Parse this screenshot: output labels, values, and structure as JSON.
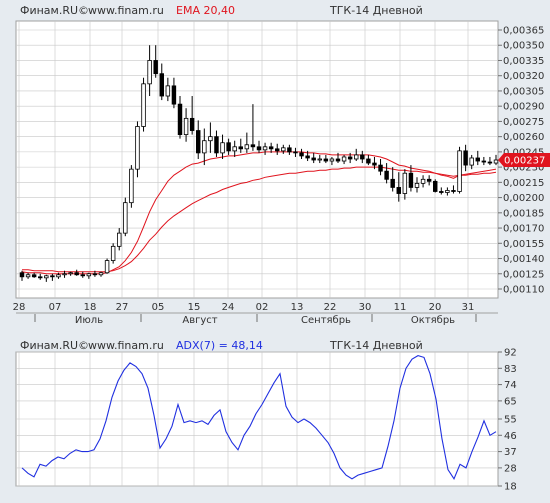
{
  "main_panel": {
    "header": {
      "brand": "Финам.RU©",
      "site": "www.finam.ru",
      "indicator": "EMA 20,40",
      "title": "ТГК-14 Дневной"
    },
    "price_tag": "0,00237",
    "x_day_ticks": [
      "28",
      "07",
      "18",
      "27",
      "05",
      "15",
      "24",
      "02",
      "13",
      "22",
      "30",
      "11",
      "20",
      "31"
    ],
    "x_month_labels": [
      "Июль",
      "Август",
      "Сентябрь",
      "Октябрь"
    ]
  },
  "adx_panel": {
    "header": {
      "brand": "Финам.RU©",
      "site": "www.finam.ru",
      "indicator": "ADX(7) = 48,14",
      "title": "ТГК-14 Дневной"
    }
  },
  "colors": {
    "background": "#e6ebf0",
    "plot_background": "#ffffff",
    "grid": "#c8c8c8",
    "ema": "#e0141e",
    "adx": "#2030e0",
    "price_tag": "#e0141e",
    "header_text": "#323232",
    "indicator_text": "#e0141e",
    "adx_indicator_text": "#2030e0"
  },
  "chart_data": [
    {
      "type": "candlestick",
      "title": "ТГК-14 Дневной",
      "ylim": [
        0.0011,
        0.00365
      ],
      "y_ticks": [
        "0,00365",
        "0,00350",
        "0,00335",
        "0,00320",
        "0,00305",
        "0,00290",
        "0,00275",
        "0,00260",
        "0,00245",
        "0,00230",
        "0,00215",
        "0,00200",
        "0,00185",
        "0,00170",
        "0,00155",
        "0,00140",
        "0,00125",
        "0,00110"
      ],
      "grid": true,
      "last_price": 0.00237,
      "ohlc": [
        [
          0.00126,
          0.00128,
          0.00118,
          0.00122
        ],
        [
          0.00122,
          0.00126,
          0.0012,
          0.00124
        ],
        [
          0.00124,
          0.00126,
          0.00121,
          0.00122
        ],
        [
          0.00122,
          0.00125,
          0.00119,
          0.00121
        ],
        [
          0.00121,
          0.00124,
          0.00117,
          0.00123
        ],
        [
          0.00123,
          0.00125,
          0.00118,
          0.00122
        ],
        [
          0.00122,
          0.00126,
          0.0012,
          0.00124
        ],
        [
          0.00124,
          0.00128,
          0.00121,
          0.00125
        ],
        [
          0.00125,
          0.00127,
          0.00123,
          0.00126
        ],
        [
          0.00126,
          0.00129,
          0.00123,
          0.00124
        ],
        [
          0.00124,
          0.00127,
          0.00121,
          0.00123
        ],
        [
          0.00123,
          0.00126,
          0.0012,
          0.00125
        ],
        [
          0.00125,
          0.00128,
          0.00122,
          0.00124
        ],
        [
          0.00124,
          0.00127,
          0.00122,
          0.00126
        ],
        [
          0.00126,
          0.0014,
          0.00125,
          0.00138
        ],
        [
          0.00138,
          0.00155,
          0.00135,
          0.00152
        ],
        [
          0.00152,
          0.0017,
          0.00148,
          0.00165
        ],
        [
          0.00165,
          0.002,
          0.00162,
          0.00195
        ],
        [
          0.00195,
          0.00232,
          0.0019,
          0.00228
        ],
        [
          0.00228,
          0.00275,
          0.0022,
          0.0027
        ],
        [
          0.0027,
          0.00318,
          0.00265,
          0.00312
        ],
        [
          0.00312,
          0.0035,
          0.003,
          0.00335
        ],
        [
          0.00335,
          0.0035,
          0.00318,
          0.00322
        ],
        [
          0.00322,
          0.00332,
          0.00296,
          0.003
        ],
        [
          0.003,
          0.00318,
          0.00295,
          0.0031
        ],
        [
          0.0031,
          0.00318,
          0.00288,
          0.00292
        ],
        [
          0.00292,
          0.003,
          0.00258,
          0.00262
        ],
        [
          0.00262,
          0.00288,
          0.00255,
          0.00278
        ],
        [
          0.00278,
          0.003,
          0.00262,
          0.00266
        ],
        [
          0.00266,
          0.00276,
          0.00238,
          0.00244
        ],
        [
          0.00244,
          0.00268,
          0.00232,
          0.00256
        ],
        [
          0.00256,
          0.00274,
          0.00244,
          0.0026
        ],
        [
          0.0026,
          0.00266,
          0.0024,
          0.00244
        ],
        [
          0.00244,
          0.00262,
          0.00238,
          0.00254
        ],
        [
          0.00254,
          0.00258,
          0.00242,
          0.00246
        ],
        [
          0.00246,
          0.00256,
          0.0024,
          0.0025
        ],
        [
          0.0025,
          0.00258,
          0.00244,
          0.00248
        ],
        [
          0.00248,
          0.00264,
          0.00244,
          0.00252
        ],
        [
          0.00252,
          0.00292,
          0.00246,
          0.0025
        ],
        [
          0.0025,
          0.00256,
          0.00244,
          0.00247
        ],
        [
          0.00247,
          0.00254,
          0.00242,
          0.0025
        ],
        [
          0.0025,
          0.00254,
          0.00244,
          0.00248
        ],
        [
          0.00248,
          0.00253,
          0.00242,
          0.00246
        ],
        [
          0.00246,
          0.00252,
          0.00243,
          0.00249
        ],
        [
          0.00249,
          0.00252,
          0.00242,
          0.00245
        ],
        [
          0.00245,
          0.00249,
          0.0024,
          0.00244
        ],
        [
          0.00244,
          0.00248,
          0.00238,
          0.00241
        ],
        [
          0.00241,
          0.00246,
          0.00236,
          0.00239
        ],
        [
          0.00239,
          0.00244,
          0.00234,
          0.00237
        ],
        [
          0.00237,
          0.00242,
          0.00234,
          0.00238
        ],
        [
          0.00238,
          0.00242,
          0.00234,
          0.00236
        ],
        [
          0.00236,
          0.0024,
          0.00232,
          0.00238
        ],
        [
          0.00238,
          0.00244,
          0.00234,
          0.00236
        ],
        [
          0.00236,
          0.00242,
          0.00233,
          0.0024
        ],
        [
          0.0024,
          0.00244,
          0.00234,
          0.00238
        ],
        [
          0.00238,
          0.00248,
          0.00236,
          0.00242
        ],
        [
          0.00242,
          0.00246,
          0.00234,
          0.00238
        ],
        [
          0.00238,
          0.00242,
          0.00232,
          0.00234
        ],
        [
          0.00234,
          0.0024,
          0.00228,
          0.00232
        ],
        [
          0.00232,
          0.00238,
          0.00222,
          0.00226
        ],
        [
          0.00226,
          0.00234,
          0.00214,
          0.00218
        ],
        [
          0.00218,
          0.0023,
          0.00206,
          0.0021
        ],
        [
          0.0021,
          0.00225,
          0.00196,
          0.00204
        ],
        [
          0.00204,
          0.00228,
          0.00198,
          0.00224
        ],
        [
          0.00224,
          0.00232,
          0.00206,
          0.0021
        ],
        [
          0.0021,
          0.0022,
          0.00205,
          0.00214
        ],
        [
          0.00214,
          0.00222,
          0.0021,
          0.00218
        ],
        [
          0.00218,
          0.00222,
          0.00212,
          0.00216
        ],
        [
          0.00216,
          0.00218,
          0.00205,
          0.00206
        ],
        [
          0.00206,
          0.0021,
          0.00203,
          0.00205
        ],
        [
          0.00205,
          0.0021,
          0.00202,
          0.00207
        ],
        [
          0.00207,
          0.00212,
          0.00204,
          0.00206
        ],
        [
          0.00206,
          0.0025,
          0.00204,
          0.00246
        ],
        [
          0.00246,
          0.00252,
          0.00226,
          0.00232
        ],
        [
          0.00232,
          0.00242,
          0.00228,
          0.00239
        ],
        [
          0.00239,
          0.00246,
          0.00232,
          0.00236
        ],
        [
          0.00236,
          0.0024,
          0.00232,
          0.00235
        ],
        [
          0.00235,
          0.0024,
          0.00232,
          0.00234
        ],
        [
          0.00234,
          0.00242,
          0.00232,
          0.00237
        ]
      ],
      "ema": [
        {
          "name": "EMA 20",
          "values": [
            0.00127,
            0.00126,
            0.00126,
            0.00126,
            0.00125,
            0.00125,
            0.00125,
            0.00125,
            0.00125,
            0.00125,
            0.00125,
            0.00125,
            0.00125,
            0.00125,
            0.00126,
            0.00129,
            0.00132,
            0.00138,
            0.00146,
            0.00157,
            0.00171,
            0.00186,
            0.00198,
            0.00207,
            0.00216,
            0.00222,
            0.00226,
            0.0023,
            0.00233,
            0.00234,
            0.00236,
            0.00238,
            0.00239,
            0.0024,
            0.00241,
            0.00241,
            0.00242,
            0.00243,
            0.00244,
            0.00244,
            0.00245,
            0.00245,
            0.00245,
            0.00245,
            0.00245,
            0.00245,
            0.00245,
            0.00244,
            0.00244,
            0.00243,
            0.00243,
            0.00242,
            0.00242,
            0.00242,
            0.00242,
            0.00242,
            0.00242,
            0.00242,
            0.00241,
            0.0024,
            0.00238,
            0.00235,
            0.00232,
            0.00231,
            0.00229,
            0.00228,
            0.00227,
            0.00226,
            0.00224,
            0.00222,
            0.00221,
            0.00219,
            0.00222,
            0.00223,
            0.00224,
            0.00225,
            0.00226,
            0.00227,
            0.00228
          ]
        },
        {
          "name": "EMA 40",
          "values": [
            0.00129,
            0.00129,
            0.00128,
            0.00128,
            0.00128,
            0.00128,
            0.00127,
            0.00127,
            0.00127,
            0.00127,
            0.00127,
            0.00127,
            0.00127,
            0.00127,
            0.00127,
            0.00128,
            0.0013,
            0.00133,
            0.00137,
            0.00143,
            0.0015,
            0.00158,
            0.00164,
            0.00171,
            0.00177,
            0.00182,
            0.00186,
            0.0019,
            0.00194,
            0.00197,
            0.002,
            0.00203,
            0.00205,
            0.00208,
            0.0021,
            0.00212,
            0.00214,
            0.00215,
            0.00217,
            0.00218,
            0.0022,
            0.00221,
            0.00222,
            0.00223,
            0.00224,
            0.00224,
            0.00225,
            0.00226,
            0.00226,
            0.00227,
            0.00227,
            0.00228,
            0.00228,
            0.00229,
            0.00229,
            0.0023,
            0.0023,
            0.0023,
            0.0023,
            0.0023,
            0.00229,
            0.00228,
            0.00227,
            0.00227,
            0.00226,
            0.00226,
            0.00225,
            0.00225,
            0.00224,
            0.00223,
            0.00222,
            0.00221,
            0.00222,
            0.00222,
            0.00223,
            0.00223,
            0.00224,
            0.00224,
            0.00225
          ]
        }
      ]
    },
    {
      "type": "line",
      "title": "ADX(7) = 48,14",
      "ylim": [
        18,
        92
      ],
      "y_ticks": [
        "92",
        "83",
        "74",
        "65",
        "55",
        "46",
        "37",
        "28",
        "18"
      ],
      "grid": true,
      "series": [
        {
          "name": "ADX(7)",
          "values": [
            28,
            25,
            23,
            30,
            29,
            32,
            34,
            33,
            36,
            38,
            37,
            37,
            38,
            44,
            54,
            67,
            76,
            82,
            86,
            84,
            80,
            72,
            57,
            39,
            44,
            51,
            63,
            53,
            54,
            53,
            54,
            52,
            57,
            60,
            48,
            42,
            38,
            46,
            51,
            58,
            63,
            69,
            75,
            80,
            62,
            56,
            53,
            55,
            53,
            50,
            46,
            42,
            36,
            28,
            24,
            22,
            24,
            25,
            26,
            27,
            28,
            40,
            54,
            72,
            83,
            88,
            90,
            89,
            80,
            66,
            44,
            27,
            22,
            30,
            28,
            37,
            45,
            54,
            46,
            48
          ]
        }
      ]
    }
  ]
}
